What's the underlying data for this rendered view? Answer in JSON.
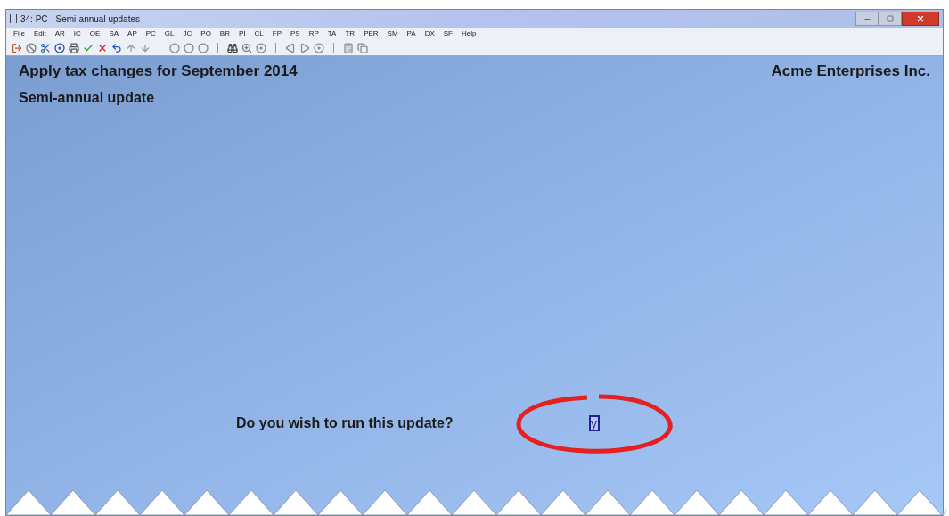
{
  "window": {
    "title": "34: PC - Semi-annual updates"
  },
  "menu": [
    "File",
    "Edit",
    "AR",
    "IC",
    "OE",
    "SA",
    "AP",
    "PC",
    "GL",
    "JC",
    "PO",
    "BR",
    "PI",
    "CL",
    "FP",
    "PS",
    "RP",
    "TA",
    "TR",
    "PER",
    "SM",
    "PA",
    "DX",
    "SF",
    "Help"
  ],
  "screen": {
    "title": "Apply tax changes for September 2014",
    "company": "Acme Enterprises Inc.",
    "subtitle": "Semi-annual update"
  },
  "prompt": {
    "label": "Do you wish to run this update?",
    "value": "y"
  }
}
